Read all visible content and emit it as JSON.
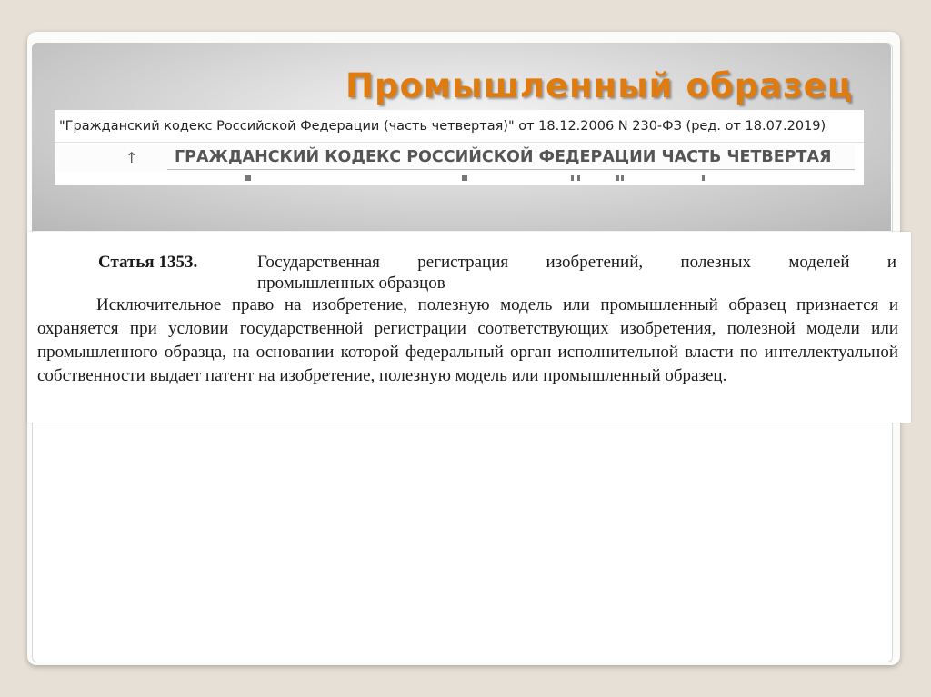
{
  "slide": {
    "title": "Промышленный образец"
  },
  "doc_header": {
    "citation": "\"Гражданский кодекс Российской Федерации (часть четвертая)\" от 18.12.2006 N 230-ФЗ (ред. от 18.07.2019)",
    "arrow_icon": "up-arrow-icon",
    "heading": "ГРАЖДАНСКИЙ КОДЕКС РОССИЙСКОЙ ФЕДЕРАЦИИ ЧАСТЬ ЧЕТВЕРТАЯ"
  },
  "article": {
    "number": "Статья 1353.",
    "title_line1": "Государственная регистрация изобретений, полезных моделей и",
    "title_line2": "промышленных образцов",
    "body": "Исключительное право на изобретение, полезную модель или промышленный образец признается и охраняется при условии государственной регистрации соответствующих изобретения, полезной модели или промышленного образца, на основании которой федеральный орган исполнительной власти по интеллектуальной собственности выдает патент на изобретение, полезную модель или промышленный образец."
  },
  "colors": {
    "title_accent": "#e07b10",
    "background": "#e6e0d6"
  }
}
